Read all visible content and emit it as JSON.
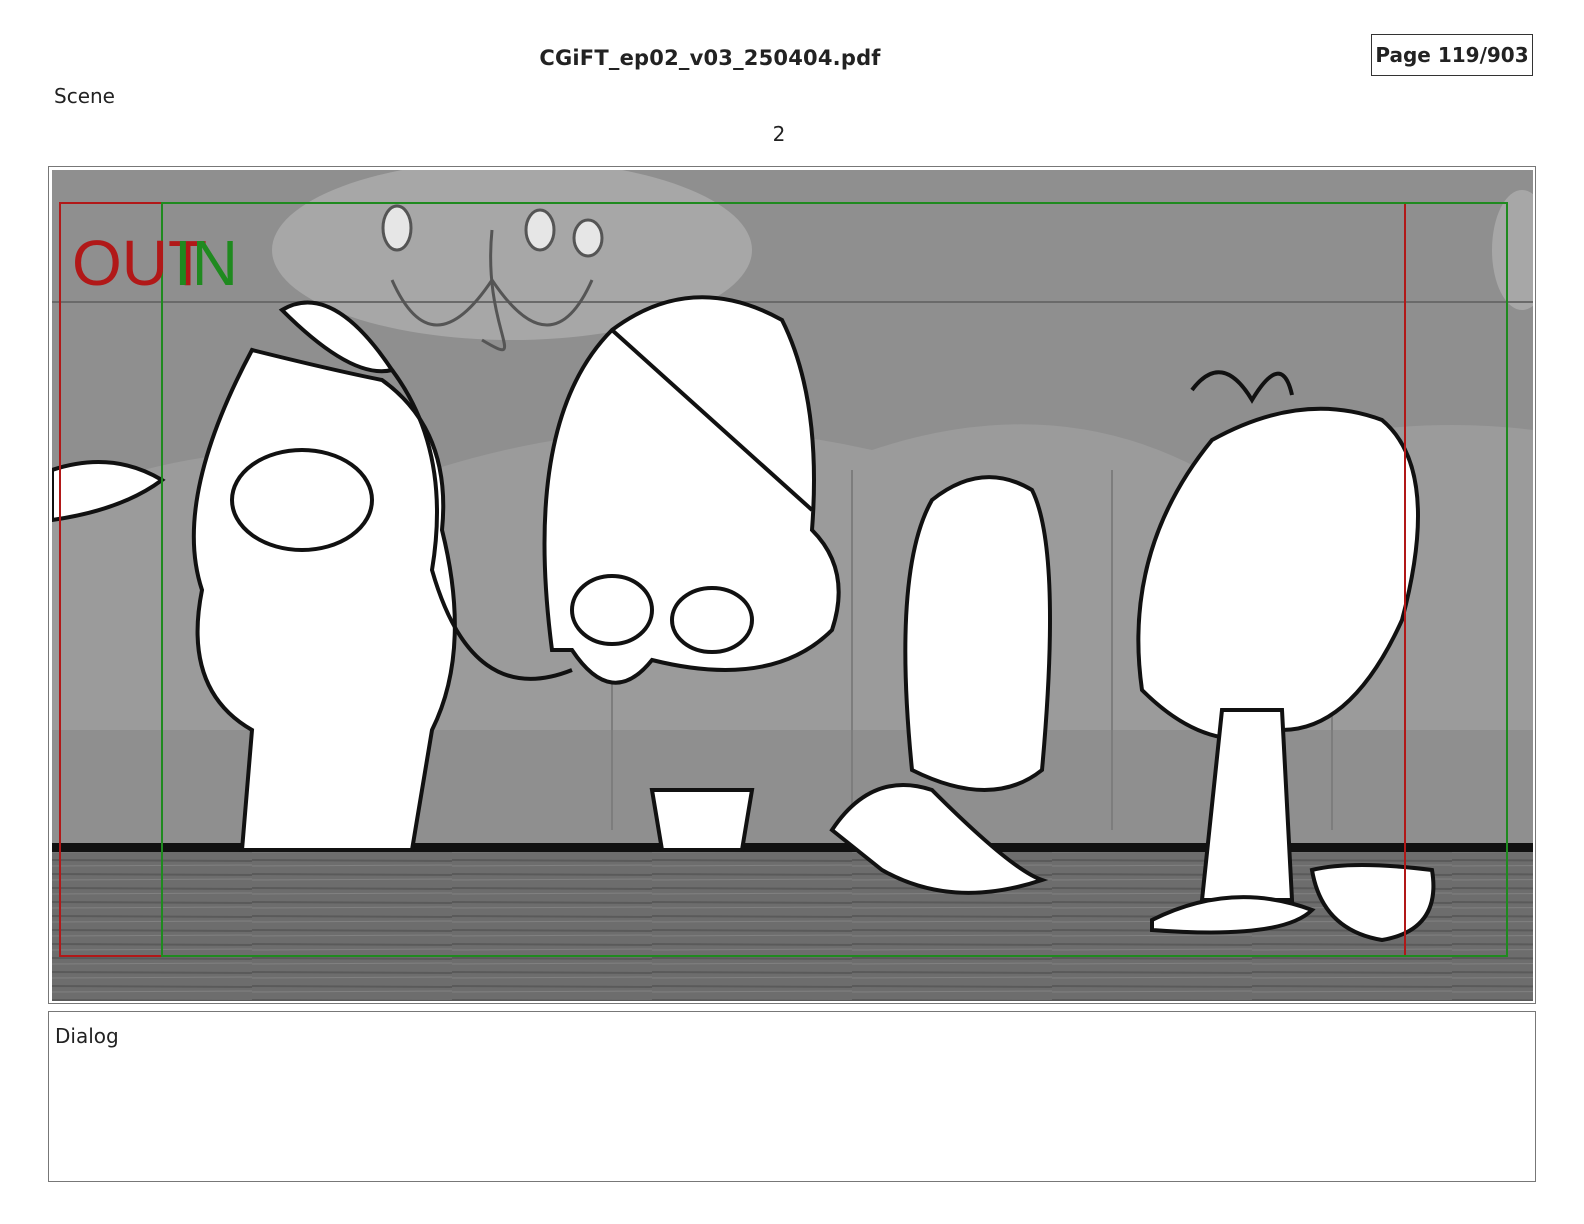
{
  "header": {
    "file_name": "CGiFT_ep02_v03_250404.pdf",
    "page_indicator": "Page 119/903"
  },
  "scene": {
    "label": "Scene",
    "number": "2"
  },
  "panel": {
    "out_marker": "OUT",
    "in_marker": "IN",
    "colors": {
      "out_frame": "#b11818",
      "in_frame": "#1f8a1f",
      "background": "#8e8e8e",
      "counter": "#555555"
    }
  },
  "dialog": {
    "label": "Dialog",
    "text": ""
  }
}
